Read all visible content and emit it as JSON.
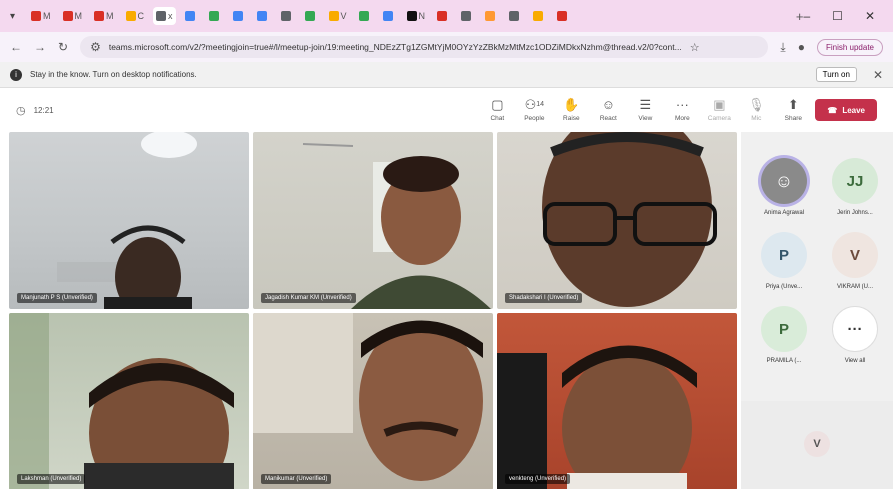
{
  "browser": {
    "tabs": [
      {
        "glyph": "M",
        "color": "#d93025"
      },
      {
        "glyph": "M",
        "color": "#d93025"
      },
      {
        "glyph": "M",
        "color": "#d93025"
      },
      {
        "glyph": "C",
        "color": "#f9ab00"
      },
      {
        "glyph": "x",
        "color": "#5f6368",
        "active": true
      },
      {
        "glyph": "",
        "color": "#4285f4"
      },
      {
        "glyph": "",
        "color": "#34a853"
      },
      {
        "glyph": "",
        "color": "#4285f4"
      },
      {
        "glyph": "",
        "color": "#4285f4"
      },
      {
        "glyph": "",
        "color": "#5f6368"
      },
      {
        "glyph": "",
        "color": "#34a853"
      },
      {
        "glyph": "V",
        "color": "#f9ab00"
      },
      {
        "glyph": "",
        "color": "#34a853"
      },
      {
        "glyph": "",
        "color": "#4285f4"
      },
      {
        "glyph": "N",
        "color": "#111111"
      },
      {
        "glyph": "",
        "color": "#d93025"
      },
      {
        "glyph": "",
        "color": "#5f6368"
      },
      {
        "glyph": "",
        "color": "#ff9933"
      },
      {
        "glyph": "",
        "color": "#5f6368"
      },
      {
        "glyph": "",
        "color": "#f9ab00"
      },
      {
        "glyph": "",
        "color": "#d93025"
      }
    ],
    "new_tab": "+",
    "minimize": "–",
    "maximize": "☐",
    "close": "✕",
    "url": "teams.microsoft.com/v2/?meetingjoin=true#/l/meetup-join/19:meeting_NDEzZTg1ZGMtYjM0OYzYzZBkMzMtMzc1ODZiMDkxNzhm@thread.v2/0?cont...",
    "finish_update": "Finish update"
  },
  "notification": {
    "text": "Stay in the know. Turn on desktop notifications.",
    "turn_on": "Turn on"
  },
  "meeting": {
    "timer": "12:21",
    "controls": {
      "chat": "Chat",
      "people": "People",
      "people_count": "14",
      "raise": "Raise",
      "react": "React",
      "view": "View",
      "more": "More",
      "camera": "Camera",
      "mic": "Mic",
      "share": "Share",
      "leave": "Leave"
    },
    "tiles": [
      {
        "name": "Manjunath P S (Unverified)"
      },
      {
        "name": "Jagadish Kumar KM (Unverified)"
      },
      {
        "name": "Shadakshari I (Unverified)"
      },
      {
        "name": "Lakshman (Unverified)"
      },
      {
        "name": "Manikumar (Unverified)"
      },
      {
        "name": "venkteng (Unverified)"
      }
    ],
    "participants": [
      {
        "initials": "",
        "name": "Anima Agrawal",
        "bg": "#8a8a8a",
        "fg": "#ffffff"
      },
      {
        "initials": "JJ",
        "name": "Jerin Johns...",
        "bg": "#d7ead7",
        "fg": "#3c6b3c"
      },
      {
        "initials": "P",
        "name": "Priya (Unve...",
        "bg": "#dde8ef",
        "fg": "#34566b"
      },
      {
        "initials": "V",
        "name": "VIKRAM (U...",
        "bg": "#efe5e0",
        "fg": "#6b4a3c"
      },
      {
        "initials": "P",
        "name": "PRAMILA (...",
        "bg": "#d9ecd9",
        "fg": "#3c6b3c"
      },
      {
        "initials": "···",
        "name": "View all",
        "bg": "#ffffff",
        "fg": "#333333"
      }
    ],
    "self_initial": "V"
  }
}
